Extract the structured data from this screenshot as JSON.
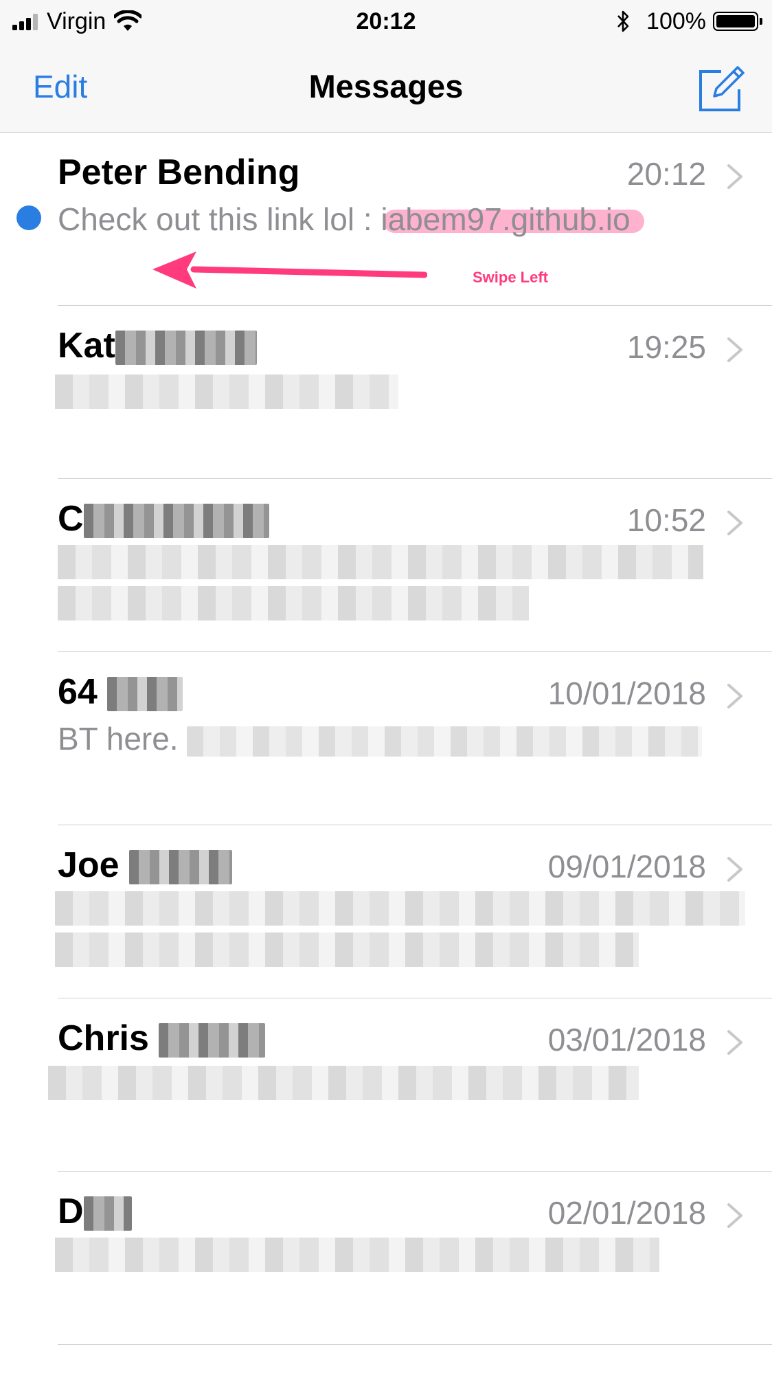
{
  "status_bar": {
    "carrier": "Virgin",
    "time": "20:12",
    "battery": "100%"
  },
  "nav": {
    "edit_label": "Edit",
    "title": "Messages",
    "compose_icon": "compose-icon"
  },
  "conversations": [
    {
      "name": "Peter Bending",
      "date": "20:12",
      "preview": "Check out this link lol : ",
      "link": "iabem97.github.io",
      "unread": true
    },
    {
      "name": "Kat",
      "date": "19:25",
      "preview": "",
      "unread": false
    },
    {
      "name": "C",
      "date": "10:52",
      "preview": "",
      "unread": false
    },
    {
      "name": "64",
      "date": "10/01/2018",
      "preview": "BT here.",
      "unread": false
    },
    {
      "name": "Joe",
      "date": "09/01/2018",
      "preview": "",
      "unread": false
    },
    {
      "name": "Chris",
      "date": "03/01/2018",
      "preview": "",
      "unread": false
    },
    {
      "name": "D",
      "date": "02/01/2018",
      "preview": "",
      "unread": false
    }
  ],
  "annotation": {
    "label": "Swipe Left",
    "color": "#ff3b7d"
  },
  "colors": {
    "accent": "#2a7de1",
    "secondary_text": "#8e8e93",
    "highlight": "#ffb2cd"
  }
}
